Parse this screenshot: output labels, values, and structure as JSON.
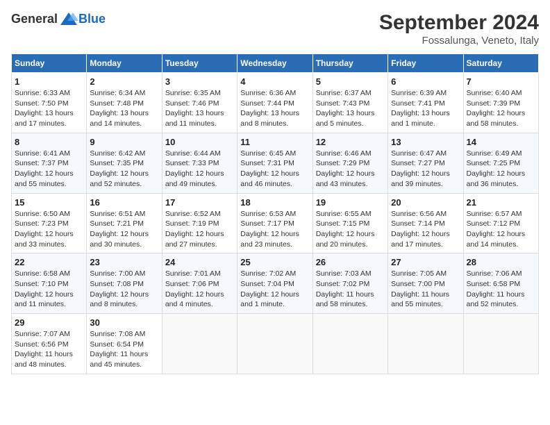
{
  "header": {
    "logo_general": "General",
    "logo_blue": "Blue",
    "title": "September 2024",
    "location": "Fossalunga, Veneto, Italy"
  },
  "columns": [
    "Sunday",
    "Monday",
    "Tuesday",
    "Wednesday",
    "Thursday",
    "Friday",
    "Saturday"
  ],
  "weeks": [
    [
      {
        "day": "1",
        "sunrise": "6:33 AM",
        "sunset": "7:50 PM",
        "daylight": "13 hours and 17 minutes."
      },
      {
        "day": "2",
        "sunrise": "6:34 AM",
        "sunset": "7:48 PM",
        "daylight": "13 hours and 14 minutes."
      },
      {
        "day": "3",
        "sunrise": "6:35 AM",
        "sunset": "7:46 PM",
        "daylight": "13 hours and 11 minutes."
      },
      {
        "day": "4",
        "sunrise": "6:36 AM",
        "sunset": "7:44 PM",
        "daylight": "13 hours and 8 minutes."
      },
      {
        "day": "5",
        "sunrise": "6:37 AM",
        "sunset": "7:43 PM",
        "daylight": "13 hours and 5 minutes."
      },
      {
        "day": "6",
        "sunrise": "6:39 AM",
        "sunset": "7:41 PM",
        "daylight": "13 hours and 1 minute."
      },
      {
        "day": "7",
        "sunrise": "6:40 AM",
        "sunset": "7:39 PM",
        "daylight": "12 hours and 58 minutes."
      }
    ],
    [
      {
        "day": "8",
        "sunrise": "6:41 AM",
        "sunset": "7:37 PM",
        "daylight": "12 hours and 55 minutes."
      },
      {
        "day": "9",
        "sunrise": "6:42 AM",
        "sunset": "7:35 PM",
        "daylight": "12 hours and 52 minutes."
      },
      {
        "day": "10",
        "sunrise": "6:44 AM",
        "sunset": "7:33 PM",
        "daylight": "12 hours and 49 minutes."
      },
      {
        "day": "11",
        "sunrise": "6:45 AM",
        "sunset": "7:31 PM",
        "daylight": "12 hours and 46 minutes."
      },
      {
        "day": "12",
        "sunrise": "6:46 AM",
        "sunset": "7:29 PM",
        "daylight": "12 hours and 43 minutes."
      },
      {
        "day": "13",
        "sunrise": "6:47 AM",
        "sunset": "7:27 PM",
        "daylight": "12 hours and 39 minutes."
      },
      {
        "day": "14",
        "sunrise": "6:49 AM",
        "sunset": "7:25 PM",
        "daylight": "12 hours and 36 minutes."
      }
    ],
    [
      {
        "day": "15",
        "sunrise": "6:50 AM",
        "sunset": "7:23 PM",
        "daylight": "12 hours and 33 minutes."
      },
      {
        "day": "16",
        "sunrise": "6:51 AM",
        "sunset": "7:21 PM",
        "daylight": "12 hours and 30 minutes."
      },
      {
        "day": "17",
        "sunrise": "6:52 AM",
        "sunset": "7:19 PM",
        "daylight": "12 hours and 27 minutes."
      },
      {
        "day": "18",
        "sunrise": "6:53 AM",
        "sunset": "7:17 PM",
        "daylight": "12 hours and 23 minutes."
      },
      {
        "day": "19",
        "sunrise": "6:55 AM",
        "sunset": "7:15 PM",
        "daylight": "12 hours and 20 minutes."
      },
      {
        "day": "20",
        "sunrise": "6:56 AM",
        "sunset": "7:14 PM",
        "daylight": "12 hours and 17 minutes."
      },
      {
        "day": "21",
        "sunrise": "6:57 AM",
        "sunset": "7:12 PM",
        "daylight": "12 hours and 14 minutes."
      }
    ],
    [
      {
        "day": "22",
        "sunrise": "6:58 AM",
        "sunset": "7:10 PM",
        "daylight": "12 hours and 11 minutes."
      },
      {
        "day": "23",
        "sunrise": "7:00 AM",
        "sunset": "7:08 PM",
        "daylight": "12 hours and 8 minutes."
      },
      {
        "day": "24",
        "sunrise": "7:01 AM",
        "sunset": "7:06 PM",
        "daylight": "12 hours and 4 minutes."
      },
      {
        "day": "25",
        "sunrise": "7:02 AM",
        "sunset": "7:04 PM",
        "daylight": "12 hours and 1 minute."
      },
      {
        "day": "26",
        "sunrise": "7:03 AM",
        "sunset": "7:02 PM",
        "daylight": "11 hours and 58 minutes."
      },
      {
        "day": "27",
        "sunrise": "7:05 AM",
        "sunset": "7:00 PM",
        "daylight": "11 hours and 55 minutes."
      },
      {
        "day": "28",
        "sunrise": "7:06 AM",
        "sunset": "6:58 PM",
        "daylight": "11 hours and 52 minutes."
      }
    ],
    [
      {
        "day": "29",
        "sunrise": "7:07 AM",
        "sunset": "6:56 PM",
        "daylight": "11 hours and 48 minutes."
      },
      {
        "day": "30",
        "sunrise": "7:08 AM",
        "sunset": "6:54 PM",
        "daylight": "11 hours and 45 minutes."
      },
      null,
      null,
      null,
      null,
      null
    ]
  ],
  "labels": {
    "sunrise": "Sunrise:",
    "sunset": "Sunset:",
    "daylight": "Daylight:"
  }
}
